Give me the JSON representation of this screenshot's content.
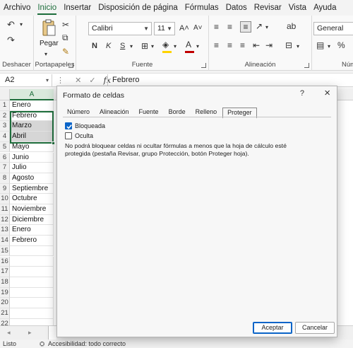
{
  "menu": [
    "Archivo",
    "Inicio",
    "Insertar",
    "Disposición de página",
    "Fórmulas",
    "Datos",
    "Revisar",
    "Vista",
    "Ayuda"
  ],
  "ribbon": {
    "undo_label": "Deshacer",
    "paste_label": "Pegar",
    "clipboard_label": "Portapapeles",
    "font_group_label": "Fuente",
    "alignment_group_label": "Alineación",
    "number_group_label": "Núme",
    "font_name": "Calibri",
    "font_size": "11",
    "bold": "N",
    "italic": "K",
    "underline": "S",
    "number_format": "General",
    "font_color": "#c00000",
    "fill_color": "#ffd400"
  },
  "formula_bar": {
    "name_box": "A2",
    "content": "Febrero"
  },
  "sheet": {
    "column_header": "A",
    "rows": [
      {
        "n": "1",
        "v": "Enero"
      },
      {
        "n": "2",
        "v": "Febrero"
      },
      {
        "n": "3",
        "v": "Marzo"
      },
      {
        "n": "4",
        "v": "Abril"
      },
      {
        "n": "5",
        "v": "Mayo"
      },
      {
        "n": "6",
        "v": "Junio"
      },
      {
        "n": "7",
        "v": "Julio"
      },
      {
        "n": "8",
        "v": "Agosto"
      },
      {
        "n": "9",
        "v": "Septiembre"
      },
      {
        "n": "10",
        "v": "Octubre"
      },
      {
        "n": "11",
        "v": "Noviembre"
      },
      {
        "n": "12",
        "v": "Diciembre"
      },
      {
        "n": "13",
        "v": "Enero"
      },
      {
        "n": "14",
        "v": "Febrero"
      },
      {
        "n": "15",
        "v": ""
      },
      {
        "n": "16",
        "v": ""
      },
      {
        "n": "17",
        "v": ""
      },
      {
        "n": "18",
        "v": ""
      },
      {
        "n": "19",
        "v": ""
      },
      {
        "n": "20",
        "v": ""
      },
      {
        "n": "21",
        "v": ""
      },
      {
        "n": "22",
        "v": ""
      }
    ]
  },
  "status": {
    "ready": "Listo",
    "accessibility": "Accesibilidad: todo correcto"
  },
  "dialog": {
    "title": "Formato de celdas",
    "help": "?",
    "close": "×",
    "tabs": [
      "Número",
      "Alineación",
      "Fuente",
      "Borde",
      "Relleno",
      "Proteger"
    ],
    "active_tab": "Proteger",
    "locked_label": "Bloqueada",
    "locked_checked": true,
    "hidden_label": "Oculta",
    "hidden_checked": false,
    "note": "No podrá bloquear celdas ni ocultar fórmulas a menos que la hoja de cálculo esté protegida (pestaña Revisar, grupo Protección, botón Proteger hoja).",
    "ok": "Aceptar",
    "cancel": "Cancelar"
  }
}
